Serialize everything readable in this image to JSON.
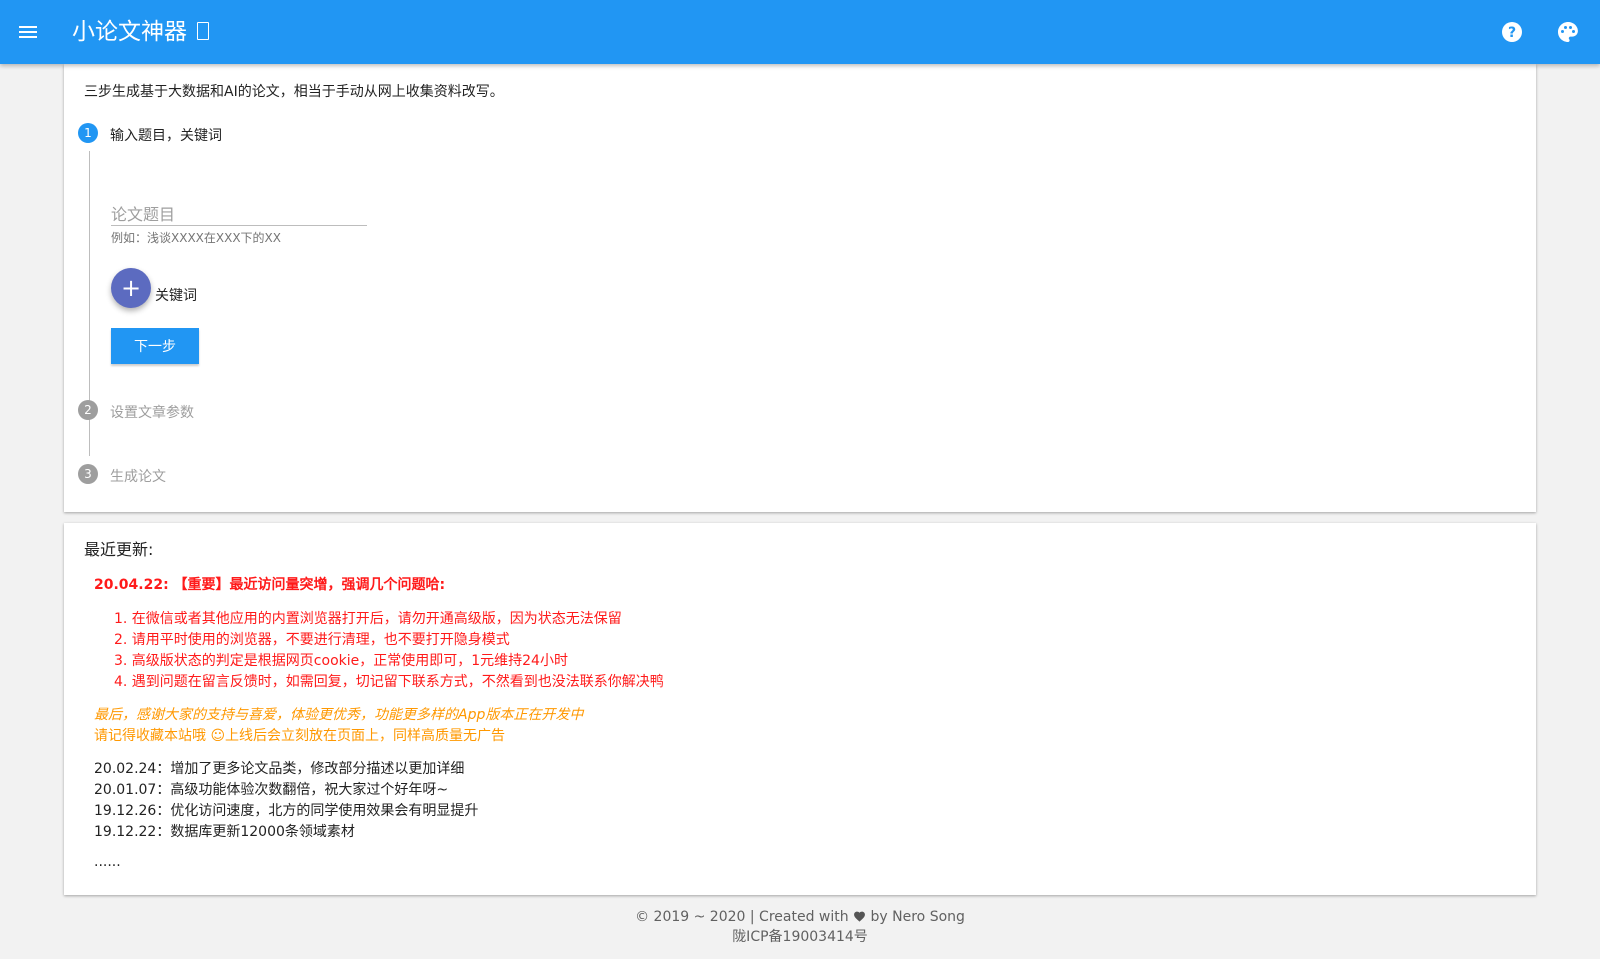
{
  "app_bar": {
    "title": "小论文神器",
    "title_icon": "box-glyph-icon",
    "menu_icon": "hamburger-menu-icon",
    "help_icon": "help-circle-icon",
    "palette_icon": "palette-icon",
    "color": "#2196f3"
  },
  "intro": "三步生成基于大数据和AI的论文，相当于手动从网上收集资料改写。",
  "steps": [
    {
      "number": "1",
      "label": "输入题目，关键词",
      "state": "active"
    },
    {
      "number": "2",
      "label": "设置文章参数",
      "state": "inactive"
    },
    {
      "number": "3",
      "label": "生成论文",
      "state": "inactive"
    }
  ],
  "step1": {
    "title_field": {
      "label": "论文题目",
      "value": "",
      "hint": "例如：浅谈XXXX在XXX下的XX"
    },
    "add_keyword_icon": "plus-icon",
    "keyword_label": "关键词",
    "next_button": "下一步"
  },
  "updates": {
    "heading": "最近更新:",
    "important": "20.04.22: 【重要】最近访问量突增，强调几个问题哈:",
    "notices": [
      "1. 在微信或者其他应用的内置浏览器打开后，请勿开通高级版，因为状态无法保留",
      "2. 请用平时使用的浏览器，不要进行清理，也不要打开隐身模式",
      "3. 高级版状态的判定是根据网页cookie，正常使用即可，1元维持24小时",
      "4. 遇到问题在留言反馈时，如需回复，切记留下联系方式，不然看到也没法联系你解决鸭"
    ],
    "thanks": "最后，感谢大家的支持与喜爱，体验更优秀，功能更多样的App版本正在开发中",
    "remember": "请记得收藏本站哦 ☺上线后会立刻放在页面上，同样高质量无广告",
    "history": [
      "20.02.24：增加了更多论文品类，修改部分描述以更加详细",
      "20.01.07：高级功能体验次数翻倍，祝大家过个好年呀~",
      "19.12.26：优化访问速度，北方的同学使用效果会有明显提升",
      "19.12.22：数据库更新12000条领域素材"
    ],
    "more": "......",
    "colors": {
      "important": "#ff1a1a",
      "thanks": "#ff9800"
    }
  },
  "footer": {
    "credit_prefix": "© 2019 ~ 2020 | Created with",
    "heart_icon": "heart-icon",
    "credit_suffix": "by Nero Song",
    "icp": "陇ICP备19003414号"
  }
}
